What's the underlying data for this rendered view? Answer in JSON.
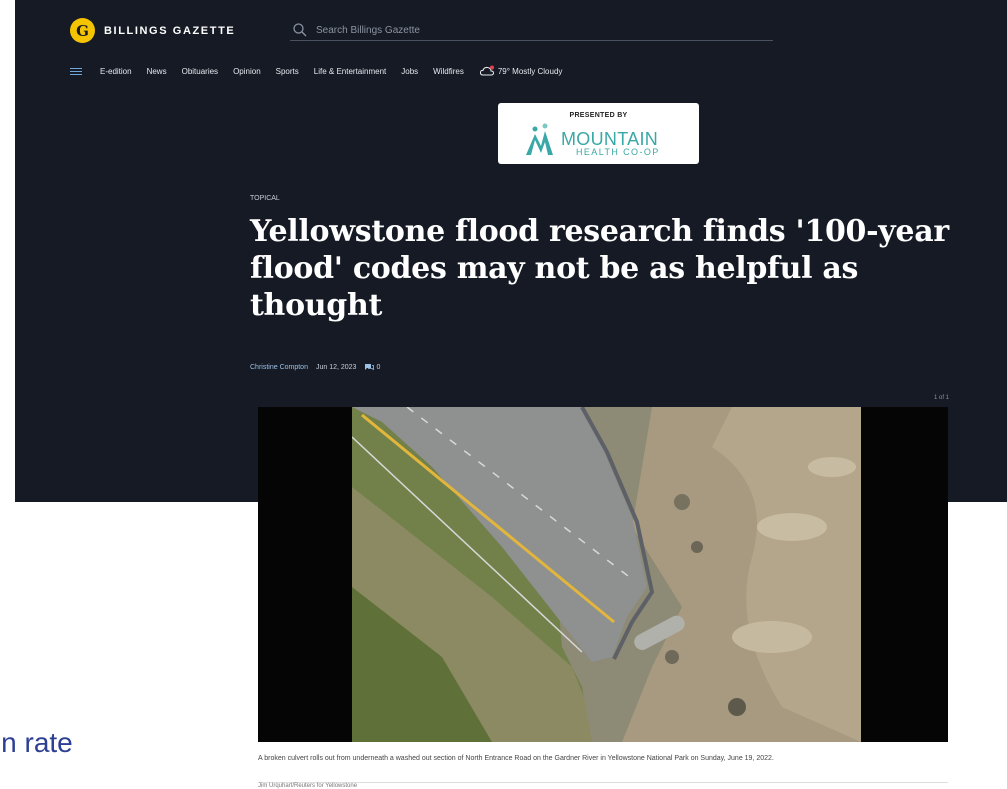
{
  "site": {
    "name": "BILLINGS GAZETTE",
    "logo_letter": "G"
  },
  "search": {
    "placeholder": "Search Billings Gazette"
  },
  "nav": {
    "items": [
      "E-edition",
      "News",
      "Obituaries",
      "Opinion",
      "Sports",
      "Life & Entertainment",
      "Jobs",
      "Wildfires"
    ],
    "weather": "79° Mostly Cloudy"
  },
  "sponsor": {
    "label": "PRESENTED BY",
    "name": "MOUNTAIN",
    "subname": "HEALTH CO-OP"
  },
  "article": {
    "topic": "TOPICAL",
    "headline": "Yellowstone flood research finds '100-year flood' codes may not be as helpful as thought",
    "author": "Christine Compton",
    "date": "Jun 12, 2023",
    "comments": "0"
  },
  "gallery": {
    "counter": "1 of 1",
    "prev": "<",
    "next": ">"
  },
  "photo": {
    "caption": "A broken culvert rolls out from underneath a washed out section of North Entrance Road on the Gardner River in Yellowstone National Park on Sunday, June 19, 2022.",
    "credit": "Jim Urquhart/Reuters for Yellowstone"
  },
  "slide_text": "pen rate",
  "colors": {
    "header_bg": "#151a24",
    "brand_yellow": "#f5c400",
    "sponsor_teal": "#3aa8a6",
    "slide_text": "#2c3f93"
  }
}
